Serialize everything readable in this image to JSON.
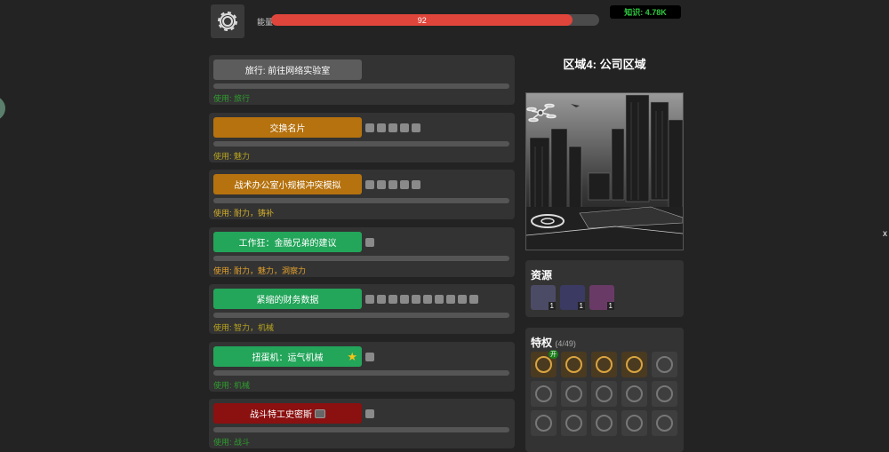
{
  "energy": {
    "label": "能量",
    "value": 92
  },
  "knowledge": {
    "label": "知识: 4.78K"
  },
  "close_label": "x",
  "actions": [
    {
      "label": "旅行: 前往网络实验室",
      "color": "gray",
      "squares": 0,
      "uses": "使用: 旅行",
      "uses_color": "green"
    },
    {
      "label": "交换名片",
      "color": "orange",
      "squares": 5,
      "uses": "使用: 魅力",
      "uses_color": "olive"
    },
    {
      "label": "战术办公室小规模冲突模拟",
      "color": "orange",
      "squares": 5,
      "uses": "使用: 耐力，铸补",
      "uses_color": "yellow"
    },
    {
      "label": "工作狂：金融兄弟的建议",
      "color": "green",
      "squares": 1,
      "uses": "使用: 耐力，魅力，洞察力",
      "uses_color": "orange"
    },
    {
      "label": "紧缩的财务数据",
      "color": "green",
      "squares": 10,
      "uses": "使用: 智力，机械",
      "uses_color": "olive"
    },
    {
      "label": "扭蛋机：运气机械",
      "color": "green",
      "squares": 1,
      "star": "★",
      "uses": "使用: 机械",
      "uses_color": "green"
    },
    {
      "label": "战斗特工史密斯",
      "color": "red",
      "squares": 1,
      "uses": "使用: 战斗",
      "uses_color": "green",
      "kbd": true
    }
  ],
  "region": {
    "title": "区域4: 公司区域"
  },
  "resources": {
    "title": "资源",
    "items": [
      {
        "icon": "potion-icon",
        "count": "1"
      },
      {
        "icon": "magnifier-icon",
        "count": "1"
      },
      {
        "icon": "gem-cluster-icon",
        "count": "1"
      }
    ]
  },
  "perks": {
    "title": "特权",
    "count": "(4/49)",
    "active_badge": "开",
    "items": [
      {
        "icon": "checkmark-medal-icon",
        "on": true
      },
      {
        "icon": "beer-mug-icon",
        "on": true
      },
      {
        "icon": "compass-badge-icon",
        "on": true
      },
      {
        "icon": "camera-badge-icon",
        "on": true
      },
      {
        "icon": "helmet-icon",
        "on": false
      },
      {
        "icon": "map-icon",
        "on": false
      },
      {
        "icon": "jar-icon",
        "on": false
      },
      {
        "icon": "fist-icon",
        "on": false
      },
      {
        "icon": "robot-icon",
        "on": false
      },
      {
        "icon": "lightning-icon",
        "on": false
      },
      {
        "icon": "coin-icon",
        "on": false
      },
      {
        "icon": "shield-icon",
        "on": false
      },
      {
        "icon": "wrench-icon",
        "on": false
      },
      {
        "icon": "crest-icon",
        "on": false
      },
      {
        "icon": "gear-badge-icon",
        "on": false
      }
    ]
  }
}
